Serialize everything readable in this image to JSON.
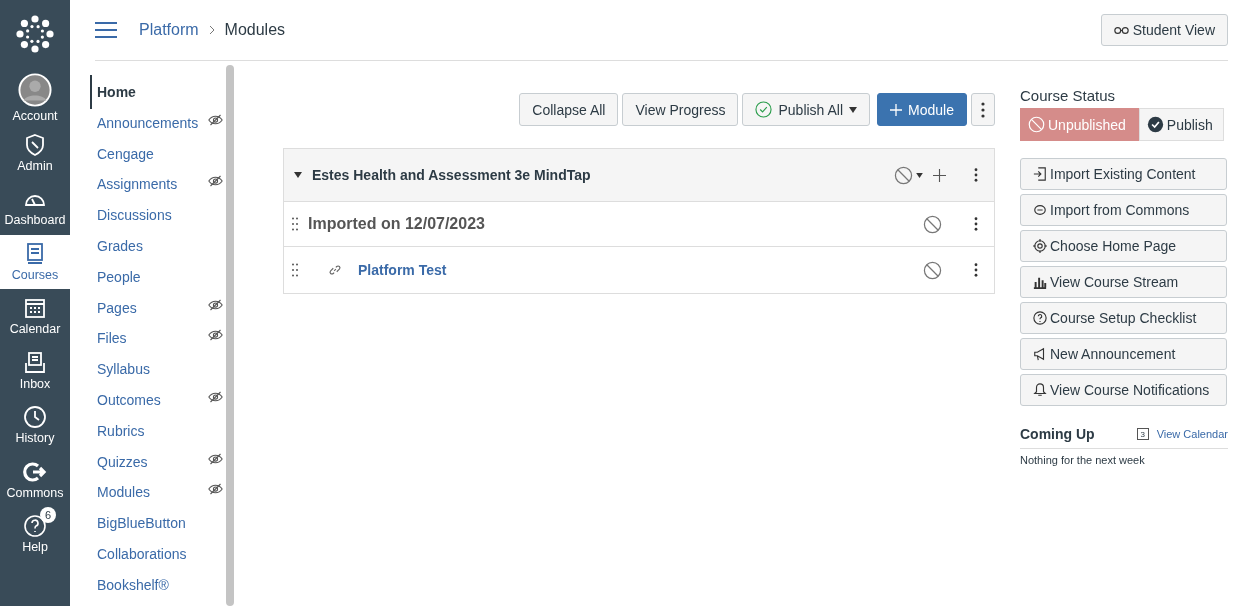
{
  "global_nav": [
    {
      "label": "Account",
      "selected": false
    },
    {
      "label": "Admin",
      "selected": false
    },
    {
      "label": "Dashboard",
      "selected": false
    },
    {
      "label": "Courses",
      "selected": true
    },
    {
      "label": "Calendar",
      "selected": false
    },
    {
      "label": "Inbox",
      "selected": false
    },
    {
      "label": "History",
      "selected": false
    },
    {
      "label": "Commons",
      "selected": false
    },
    {
      "label": "Help",
      "selected": false,
      "badge": "6"
    }
  ],
  "breadcrumb": [
    "Platform",
    "Modules"
  ],
  "student_view_button": "Student View",
  "course_nav": [
    {
      "label": "Home",
      "selected": true,
      "hidden": false
    },
    {
      "label": "Announcements",
      "selected": false,
      "hidden": true
    },
    {
      "label": "Cengage",
      "selected": false,
      "hidden": false
    },
    {
      "label": "Assignments",
      "selected": false,
      "hidden": true
    },
    {
      "label": "Discussions",
      "selected": false,
      "hidden": false
    },
    {
      "label": "Grades",
      "selected": false,
      "hidden": false
    },
    {
      "label": "People",
      "selected": false,
      "hidden": false
    },
    {
      "label": "Pages",
      "selected": false,
      "hidden": true
    },
    {
      "label": "Files",
      "selected": false,
      "hidden": true
    },
    {
      "label": "Syllabus",
      "selected": false,
      "hidden": false
    },
    {
      "label": "Outcomes",
      "selected": false,
      "hidden": true
    },
    {
      "label": "Rubrics",
      "selected": false,
      "hidden": false
    },
    {
      "label": "Quizzes",
      "selected": false,
      "hidden": true
    },
    {
      "label": "Modules",
      "selected": false,
      "hidden": true
    },
    {
      "label": "BigBlueButton",
      "selected": false,
      "hidden": false
    },
    {
      "label": "Collaborations",
      "selected": false,
      "hidden": false
    },
    {
      "label": "Bookshelf®",
      "selected": false,
      "hidden": false
    }
  ],
  "toolbar": {
    "collapse_all": "Collapse All",
    "view_progress": "View Progress",
    "publish_all": "Publish All",
    "add_module": "Module"
  },
  "module": {
    "title": "Estes Health and Assessment 3e MindTap",
    "expanded": true,
    "published": false,
    "items": [
      {
        "kind": "subheader",
        "title": "Imported on 12/07/2023",
        "published": false
      },
      {
        "kind": "link",
        "title": "Platform Test",
        "published": false
      }
    ]
  },
  "course_status": {
    "heading": "Course Status",
    "options": [
      {
        "label": "Unpublished",
        "selected": true
      },
      {
        "label": "Publish",
        "selected": false
      }
    ]
  },
  "sidebar_buttons": [
    "Import Existing Content",
    "Import from Commons",
    "Choose Home Page",
    "View Course Stream",
    "Course Setup Checklist",
    "New Announcement",
    "View Course Notifications"
  ],
  "coming_up": {
    "heading": "Coming Up",
    "link": "View Calendar",
    "calendar_day": "3",
    "empty_text": "Nothing for the next week"
  }
}
